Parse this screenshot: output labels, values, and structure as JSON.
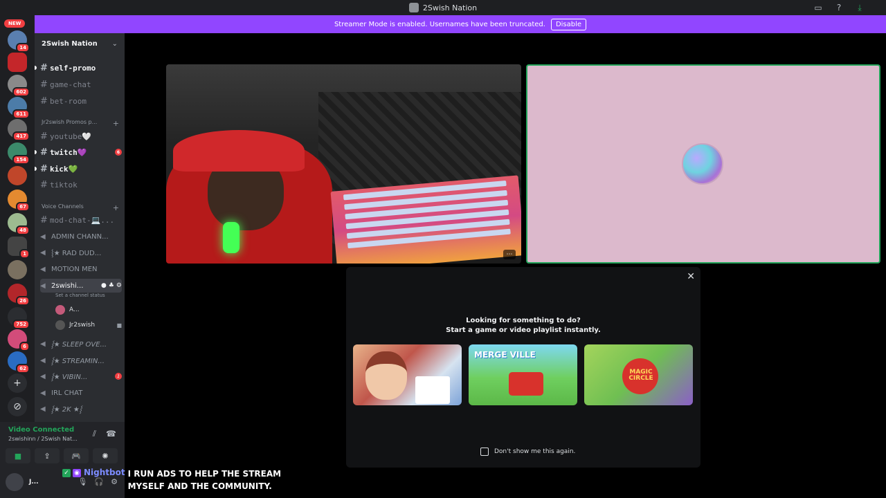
{
  "titlebar": {
    "title": "2Swish Nation",
    "icons": [
      "inbox-icon",
      "help-icon",
      "download-icon"
    ]
  },
  "banner": {
    "text": "Streamer Mode is enabled. Usernames have been truncated.",
    "button": "Disable"
  },
  "guilds": {
    "new_label": "NEW",
    "badges": [
      "14",
      "602",
      "611",
      "417",
      "154",
      "67",
      "48",
      "1",
      "26",
      "752",
      "6",
      "62"
    ]
  },
  "server": {
    "name": "2Swish Nation"
  },
  "channels": {
    "top": [
      {
        "name": "self-promo"
      },
      {
        "name": "game-chat"
      },
      {
        "name": "bet-room"
      }
    ],
    "category1": "Jr2swish Promos p...",
    "promo": [
      {
        "name": "youtube🤍"
      },
      {
        "name": "twitch💜",
        "badge": "6"
      },
      {
        "name": "kick💚"
      },
      {
        "name": "tiktok"
      }
    ],
    "category2": "Voice Channels",
    "voice": [
      {
        "name": "mod-chat-💻..."
      },
      {
        "name": "ADMIN CHANN..."
      },
      {
        "name": "⸾★ RAD DUD..."
      },
      {
        "name": "MOTION MEN"
      },
      {
        "name": "2swishi..."
      }
    ],
    "status_hint": "Set a channel status",
    "voice_users": [
      {
        "name": "A..."
      },
      {
        "name": "Jr2swish"
      }
    ],
    "voice_more": [
      {
        "name": "⸾★ SLEEP OVE..."
      },
      {
        "name": "⸾★ STREAMIN..."
      },
      {
        "name": "⸾★ VIBIN...",
        "badge": "1"
      },
      {
        "name": "IRL CHAT"
      },
      {
        "name": "⸾★ 2K ★⸾"
      }
    ]
  },
  "voice_panel": {
    "status": "Video Connected",
    "location": "2swishinn / 2Swish Nat...",
    "user": "J..."
  },
  "activity": {
    "line1": "Looking for something to do?",
    "line2": "Start a game or video playlist instantly.",
    "games": [
      {
        "logo": ""
      },
      {
        "logo": "MERGE VILLE"
      },
      {
        "logo": "MAGIC CIRCLE"
      }
    ],
    "dont_show": "Don't show me this again."
  },
  "chat_overlay": {
    "bot": "Nightbot",
    "message": "I RUN ADS TO HELP THE STREAM MYSELF AND THE COMMUNITY."
  },
  "colors": {
    "accent": "#9146ff",
    "connected": "#23a55a",
    "badge": "#f23f42"
  }
}
